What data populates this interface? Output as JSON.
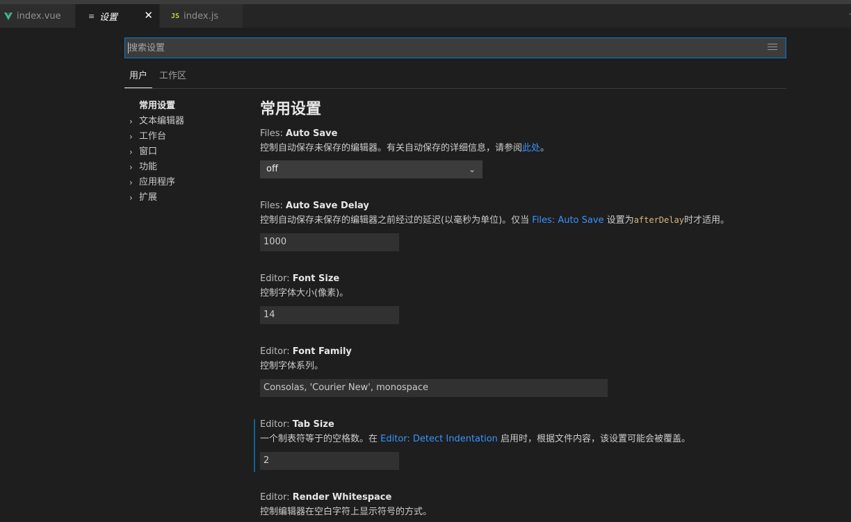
{
  "tabs": [
    {
      "label": "index.vue",
      "icon": "vue-icon"
    },
    {
      "label": "设置",
      "icon": "settings-icon",
      "active": true
    },
    {
      "label": "index.js",
      "icon": "js-icon"
    }
  ],
  "search": {
    "placeholder": "搜索设置"
  },
  "scopes": {
    "user": "用户",
    "workspace": "工作区"
  },
  "toc": {
    "selected": "常用设置",
    "items": [
      "文本编辑器",
      "工作台",
      "窗口",
      "功能",
      "应用程序",
      "扩展"
    ]
  },
  "section": {
    "title": "常用设置"
  },
  "settings": {
    "autosave": {
      "category": "Files: ",
      "key": "Auto Save",
      "desc": "控制自动保存未保存的编辑器。有关自动保存的详细信息，请参阅",
      "link": "此处",
      "desc_end": "。",
      "value": "off"
    },
    "autosave_delay": {
      "category": "Files: ",
      "key": "Auto Save Delay",
      "desc": "控制自动保存未保存的编辑器之前经过的延迟(以毫秒为单位)。仅当 ",
      "link": "Files: Auto Save",
      "desc_mid": " 设置为",
      "code": "afterDelay",
      "desc_end": "时才适用。",
      "value": "1000"
    },
    "font_size": {
      "category": "Editor: ",
      "key": "Font Size",
      "desc": "控制字体大小(像素)。",
      "value": "14"
    },
    "font_family": {
      "category": "Editor: ",
      "key": "Font Family",
      "desc": "控制字体系列。",
      "value": "Consolas, 'Courier New', monospace"
    },
    "tab_size": {
      "category": "Editor: ",
      "key": "Tab Size",
      "desc": "一个制表符等于的空格数。在 ",
      "link": "Editor: Detect Indentation",
      "desc_end": " 启用时，根据文件内容，该设置可能会被覆盖。",
      "value": "2"
    },
    "render_whitespace": {
      "category": "Editor: ",
      "key": "Render Whitespace",
      "desc": "控制编辑器在空白字符上显示符号的方式。"
    }
  },
  "colors": {
    "accent": "#007fd4",
    "link": "#3794ff",
    "background": "#1e1e1e"
  }
}
